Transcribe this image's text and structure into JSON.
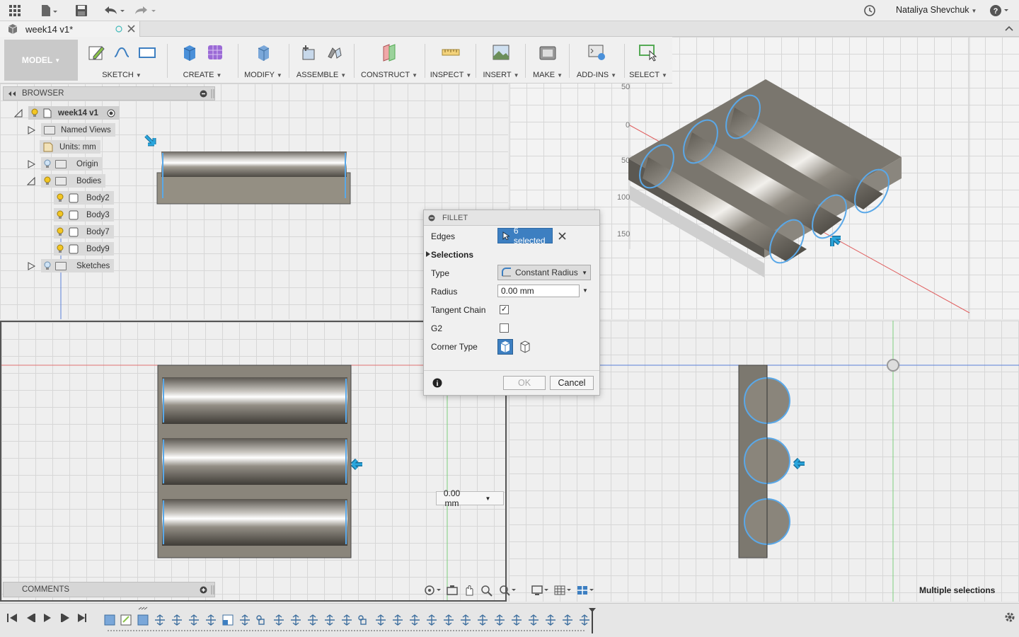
{
  "user": {
    "name": "Nataliya Shevchuk"
  },
  "tab": {
    "title": "week14 v1*"
  },
  "toolbar": {
    "workspace": "MODEL",
    "groups": [
      {
        "label": "SKETCH"
      },
      {
        "label": "CREATE"
      },
      {
        "label": "MODIFY"
      },
      {
        "label": "ASSEMBLE"
      },
      {
        "label": "CONSTRUCT"
      },
      {
        "label": "INSPECT"
      },
      {
        "label": "INSERT"
      },
      {
        "label": "MAKE"
      },
      {
        "label": "ADD-INS"
      },
      {
        "label": "SELECT"
      }
    ]
  },
  "browser": {
    "title": "BROWSER",
    "items": [
      {
        "label": "week14 v1"
      },
      {
        "label": "Named Views"
      },
      {
        "label": "Units: mm"
      },
      {
        "label": "Origin"
      },
      {
        "label": "Bodies"
      },
      {
        "label": "Body2"
      },
      {
        "label": "Body3"
      },
      {
        "label": "Body7"
      },
      {
        "label": "Body9"
      },
      {
        "label": "Sketches"
      }
    ]
  },
  "fillet": {
    "title": "FILLET",
    "edges_label": "Edges",
    "edges_value": "6 selected",
    "selections_label": "Selections",
    "type_label": "Type",
    "type_value": "Constant Radius",
    "radius_label": "Radius",
    "radius_value": "0.00 mm",
    "tangent_label": "Tangent Chain",
    "tangent_checked": true,
    "g2_label": "G2",
    "g2_checked": false,
    "corner_label": "Corner Type",
    "ok_label": "OK",
    "cancel_label": "Cancel"
  },
  "viewport": {
    "radius_input": "0.00 mm",
    "axis_labels": [
      "50",
      "0",
      "50",
      "100",
      "150"
    ]
  },
  "comments": {
    "title": "COMMENTS"
  },
  "status": {
    "text": "Multiple selections"
  },
  "colors": {
    "accent": "#3d7fc1",
    "selection": "#5aa8e8",
    "arrow": "#1a9bd7",
    "x_axis": "#e06060",
    "y_axis": "#60b060",
    "z_axis": "#5a7fd8"
  }
}
